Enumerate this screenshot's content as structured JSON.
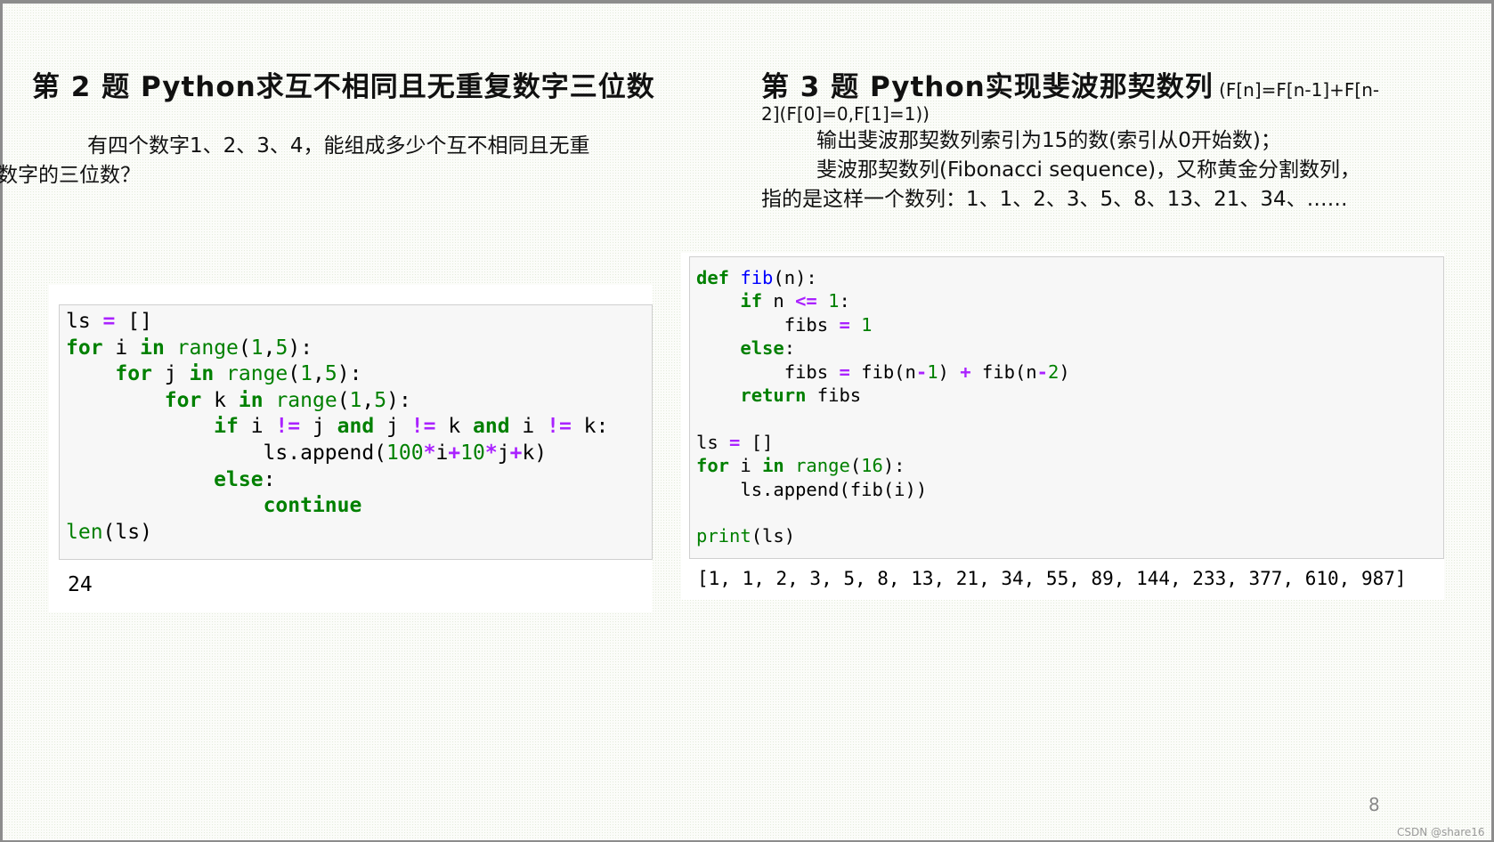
{
  "left": {
    "title": "第 2 题  Python求互不相同且无重复数字三位数",
    "desc_line1": "有四个数字1、2、3、4，能组成多少个互不相同且无重",
    "desc_line2": "复数字的三位数？",
    "code": [
      [
        [
          "",
          "ls "
        ],
        [
          "o",
          "="
        ],
        [
          "",
          " []"
        ]
      ],
      [
        [
          "k",
          "for"
        ],
        [
          "",
          " i "
        ],
        [
          "k",
          "in"
        ],
        [
          "",
          " "
        ],
        [
          "b",
          "range"
        ],
        [
          "",
          "("
        ],
        [
          "n",
          "1"
        ],
        [
          "",
          ","
        ],
        [
          "n",
          "5"
        ],
        [
          "",
          "):"
        ]
      ],
      [
        [
          "",
          "    "
        ],
        [
          "k",
          "for"
        ],
        [
          "",
          " j "
        ],
        [
          "k",
          "in"
        ],
        [
          "",
          " "
        ],
        [
          "b",
          "range"
        ],
        [
          "",
          "("
        ],
        [
          "n",
          "1"
        ],
        [
          "",
          ","
        ],
        [
          "n",
          "5"
        ],
        [
          "",
          "):"
        ]
      ],
      [
        [
          "",
          "        "
        ],
        [
          "k",
          "for"
        ],
        [
          "",
          " k "
        ],
        [
          "k",
          "in"
        ],
        [
          "",
          " "
        ],
        [
          "b",
          "range"
        ],
        [
          "",
          "("
        ],
        [
          "n",
          "1"
        ],
        [
          "",
          ","
        ],
        [
          "n",
          "5"
        ],
        [
          "",
          "):"
        ]
      ],
      [
        [
          "",
          "            "
        ],
        [
          "k",
          "if"
        ],
        [
          "",
          " i "
        ],
        [
          "o",
          "!="
        ],
        [
          "",
          " j "
        ],
        [
          "k",
          "and"
        ],
        [
          "",
          " j "
        ],
        [
          "o",
          "!="
        ],
        [
          "",
          " k "
        ],
        [
          "k",
          "and"
        ],
        [
          "",
          " i "
        ],
        [
          "o",
          "!="
        ],
        [
          "",
          " k:"
        ]
      ],
      [
        [
          "",
          "                ls.append("
        ],
        [
          "n",
          "100"
        ],
        [
          "o",
          "*"
        ],
        [
          "",
          "i"
        ],
        [
          "o",
          "+"
        ],
        [
          "n",
          "10"
        ],
        [
          "o",
          "*"
        ],
        [
          "",
          "j"
        ],
        [
          "o",
          "+"
        ],
        [
          "",
          "k)"
        ]
      ],
      [
        [
          "",
          "            "
        ],
        [
          "k",
          "else"
        ],
        [
          "",
          ":"
        ]
      ],
      [
        [
          "",
          "                "
        ],
        [
          "k",
          "continue"
        ]
      ],
      [
        [
          "b",
          "len"
        ],
        [
          "",
          "(ls)"
        ]
      ]
    ],
    "output": "24"
  },
  "right": {
    "title": "第 3 题  Python实现斐波那契数列",
    "formula_a": " (F[n]=F[n-1]+F[n-",
    "formula_b": "2](F[0]=0,F[1]=1))",
    "desc_line1": "输出斐波那契数列索引为15的数(索引从0开始数)；",
    "desc_line2": "斐波那契数列(Fibonacci sequence)，又称黄金分割数列，",
    "desc_line3": "指的是这样一个数列：1、1、2、3、5、8、13、21、34、……",
    "code": [
      [
        [
          "k",
          "def"
        ],
        [
          "",
          " "
        ],
        [
          "f",
          "fib"
        ],
        [
          "",
          "(n):"
        ]
      ],
      [
        [
          "",
          "    "
        ],
        [
          "k",
          "if"
        ],
        [
          "",
          " n "
        ],
        [
          "o",
          "<="
        ],
        [
          "",
          " "
        ],
        [
          "n",
          "1"
        ],
        [
          "",
          ":"
        ]
      ],
      [
        [
          "",
          "        fibs "
        ],
        [
          "o",
          "="
        ],
        [
          "",
          " "
        ],
        [
          "n",
          "1"
        ]
      ],
      [
        [
          "",
          "    "
        ],
        [
          "k",
          "else"
        ],
        [
          "",
          ":"
        ]
      ],
      [
        [
          "",
          "        fibs "
        ],
        [
          "o",
          "="
        ],
        [
          "",
          " fib(n"
        ],
        [
          "o",
          "-"
        ],
        [
          "n",
          "1"
        ],
        [
          "",
          ") "
        ],
        [
          "o",
          "+"
        ],
        [
          "",
          " fib(n"
        ],
        [
          "o",
          "-"
        ],
        [
          "n",
          "2"
        ],
        [
          "",
          ")"
        ]
      ],
      [
        [
          "",
          "    "
        ],
        [
          "k",
          "return"
        ],
        [
          "",
          " fibs"
        ]
      ],
      [
        [
          "",
          ""
        ]
      ],
      [
        [
          "",
          "ls "
        ],
        [
          "o",
          "="
        ],
        [
          "",
          " []"
        ]
      ],
      [
        [
          "k",
          "for"
        ],
        [
          "",
          " i "
        ],
        [
          "k",
          "in"
        ],
        [
          "",
          " "
        ],
        [
          "b",
          "range"
        ],
        [
          "",
          "("
        ],
        [
          "n",
          "16"
        ],
        [
          "",
          "):"
        ]
      ],
      [
        [
          "",
          "    ls.append(fib(i))"
        ]
      ],
      [
        [
          "",
          ""
        ]
      ],
      [
        [
          "b",
          "print"
        ],
        [
          "",
          "(ls)"
        ]
      ]
    ],
    "output": "[1, 1, 2, 3, 5, 8, 13, 21, 34, 55, 89, 144, 233, 377, 610, 987]"
  },
  "page_number": "8",
  "watermark": "CSDN @share16"
}
